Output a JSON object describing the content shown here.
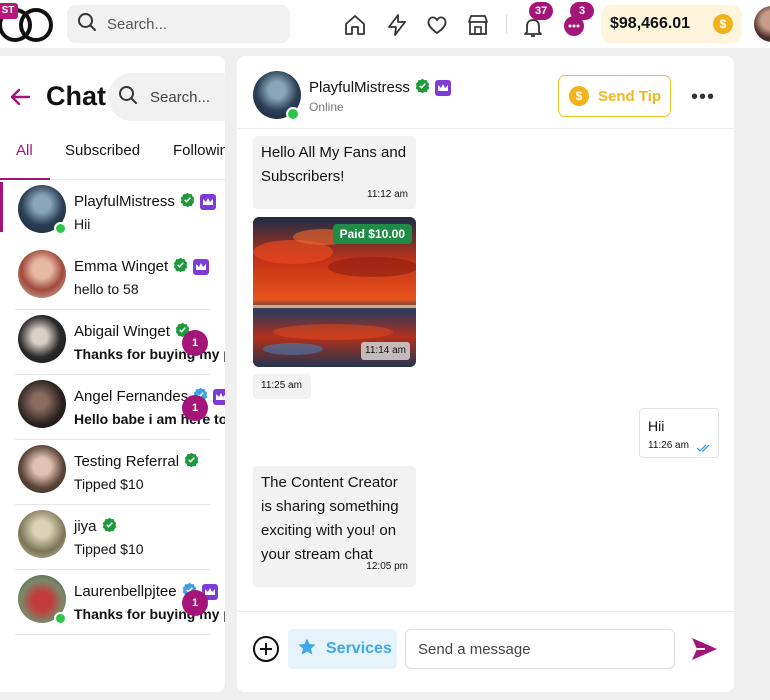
{
  "topbar": {
    "logo_badge": "ST",
    "search_placeholder": "Search...",
    "notifications_count": "37",
    "messages_count": "3",
    "balance": "$98,466.01"
  },
  "sidebar": {
    "title": "Chat",
    "search_placeholder": "Search...",
    "tabs": [
      "All",
      "Subscribed",
      "Following"
    ],
    "active_tab": "All",
    "conversations": [
      {
        "name": "PlayfulMistress",
        "preview": "Hii",
        "verified": "green",
        "crown": true,
        "online": true,
        "unread": "",
        "bold": false,
        "active": true
      },
      {
        "name": "Emma Winget",
        "preview": "hello to 58",
        "verified": "green",
        "crown": true,
        "online": false,
        "unread": "",
        "bold": false
      },
      {
        "name": "Abigail Winget",
        "preview": "Thanks for buying my post",
        "verified": "green",
        "crown": false,
        "online": false,
        "unread": "1",
        "bold": true
      },
      {
        "name": "Angel Fernandes",
        "preview": "Hello babe i am here to",
        "verified": "blue",
        "crown": true,
        "online": false,
        "unread": "1",
        "bold": true
      },
      {
        "name": "Testing Referral",
        "preview": "Tipped $10",
        "verified": "green",
        "crown": false,
        "online": false,
        "unread": "",
        "bold": false
      },
      {
        "name": "jiya",
        "preview": "Tipped $10",
        "verified": "green",
        "crown": false,
        "online": false,
        "unread": "",
        "bold": false
      },
      {
        "name": "Laurenbellpjtee",
        "preview": "Thanks for buying my post",
        "verified": "blue",
        "crown": true,
        "online": true,
        "unread": "1",
        "bold": true
      }
    ]
  },
  "chat": {
    "name": "PlayfulMistress",
    "status": "Online",
    "send_tip_label": "Send Tip",
    "messages": {
      "m1_text": "Hello All My Fans and Subscribers!",
      "m1_time": "11:12 am",
      "media_price": "Paid $10.00",
      "media_time": "11:14 am",
      "m2_time": "11:25 am",
      "m3_text": "Hii",
      "m3_time": "11:26 am",
      "m4_text": "The Content Creator is sharing something exciting with you! on your stream chat",
      "m4_time": "12:05 pm"
    },
    "composer": {
      "services_label": "Services",
      "input_placeholder": "Send a message"
    }
  },
  "colors": {
    "accent": "#a4157a",
    "gold": "#f3b21c",
    "online": "#2ec44a",
    "verified": "#1f9a3a",
    "crown": "#7d3cd6",
    "services": "#40a9e5"
  }
}
